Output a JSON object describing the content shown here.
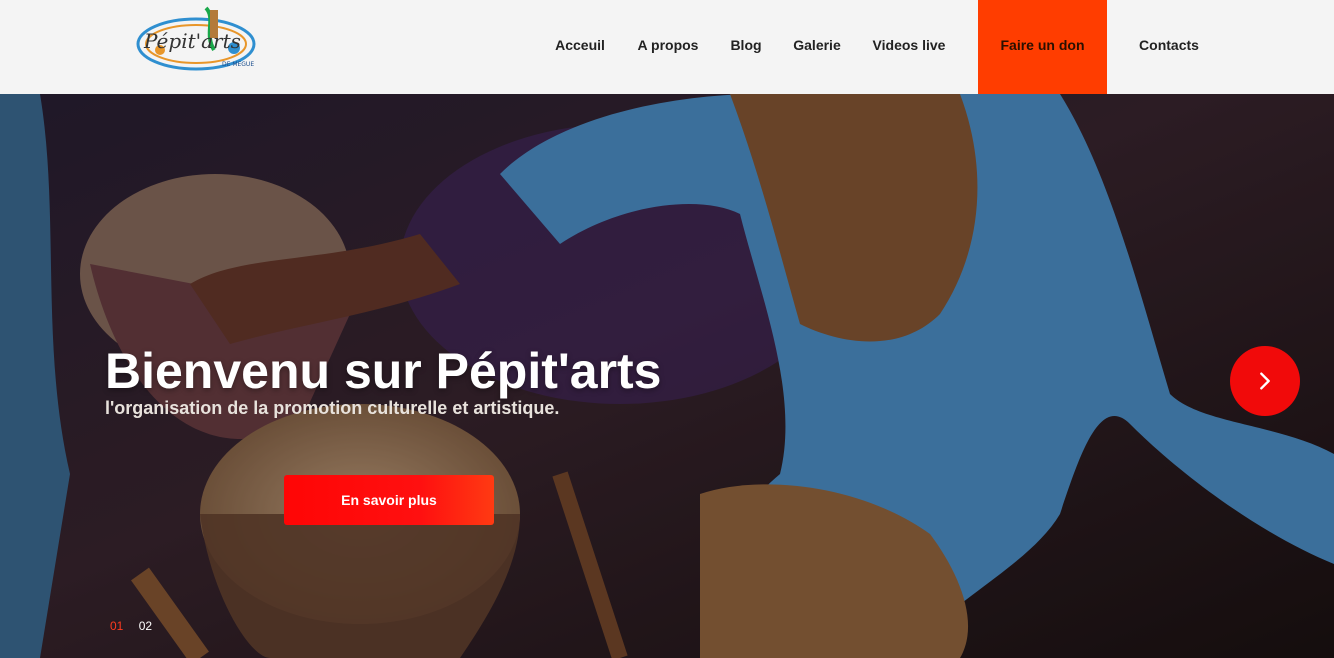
{
  "header": {
    "logo_text": "Pépit'arts",
    "logo_ring_text": "DE MEGUE",
    "nav": [
      {
        "label": "Acceuil"
      },
      {
        "label": "A propos"
      },
      {
        "label": "Blog"
      },
      {
        "label": "Galerie"
      },
      {
        "label": "Videos live"
      },
      {
        "label": "Faire un don"
      },
      {
        "label": "Contacts"
      }
    ],
    "cta_color": "#ff3d00"
  },
  "hero": {
    "title": "Bienvenu sur Pépit'arts",
    "subtitle": "l'organisation de la promotion culturelle et artistique.",
    "button_label": "En savoir plus",
    "next_icon": "chevron-right-icon",
    "slides": [
      {
        "label": "01",
        "active": true
      },
      {
        "label": "02",
        "active": false
      }
    ],
    "accent_color": "#f10a0a"
  }
}
